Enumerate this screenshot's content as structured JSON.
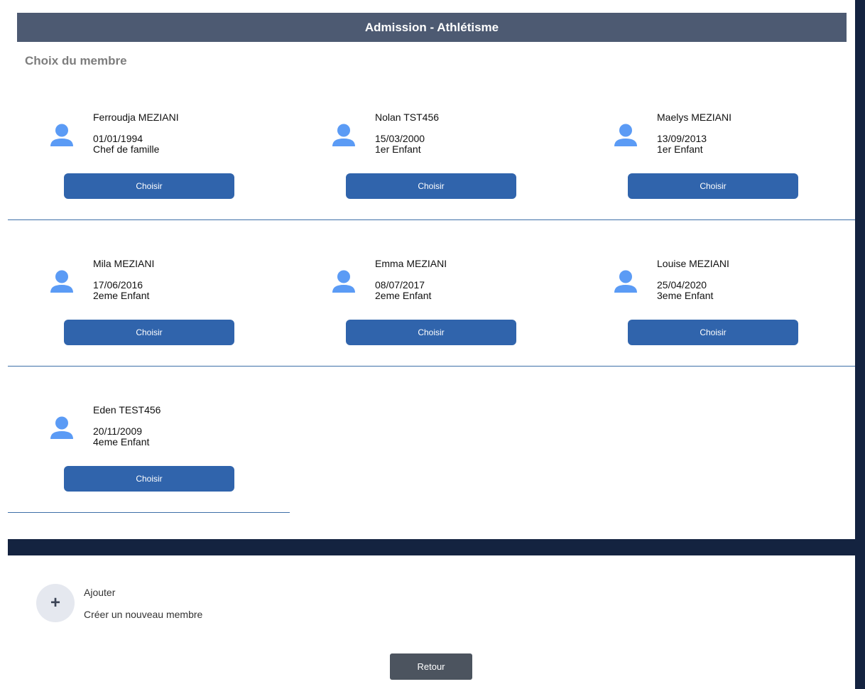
{
  "header": {
    "title": "Admission - Athlétisme"
  },
  "subtitle": "Choix du membre",
  "members": [
    {
      "name": "Ferroudja MEZIANI",
      "dob": "01/01/1994",
      "role": "Chef de famille",
      "button": "Choisir"
    },
    {
      "name": "Nolan TST456",
      "dob": "15/03/2000",
      "role": "1er Enfant",
      "button": "Choisir"
    },
    {
      "name": "Maelys MEZIANI",
      "dob": "13/09/2013",
      "role": "1er Enfant",
      "button": "Choisir"
    },
    {
      "name": "Mila MEZIANI",
      "dob": "17/06/2016",
      "role": "2eme Enfant",
      "button": "Choisir"
    },
    {
      "name": "Emma MEZIANI",
      "dob": "08/07/2017",
      "role": "2eme Enfant",
      "button": "Choisir"
    },
    {
      "name": "Louise MEZIANI",
      "dob": "25/04/2020",
      "role": "3eme Enfant",
      "button": "Choisir"
    },
    {
      "name": "Eden TEST456",
      "dob": "20/11/2009",
      "role": "4eme Enfant",
      "button": "Choisir"
    }
  ],
  "add": {
    "icon": "plus-icon",
    "label": "Ajouter",
    "description": "Créer un nouveau membre"
  },
  "footer": {
    "back_label": "Retour"
  },
  "colors": {
    "header_bg": "#4d5a72",
    "button_bg": "#3064ac",
    "avatar": "#5b9bf5",
    "dark_band": "#142340",
    "back_bg": "#4c545f"
  }
}
